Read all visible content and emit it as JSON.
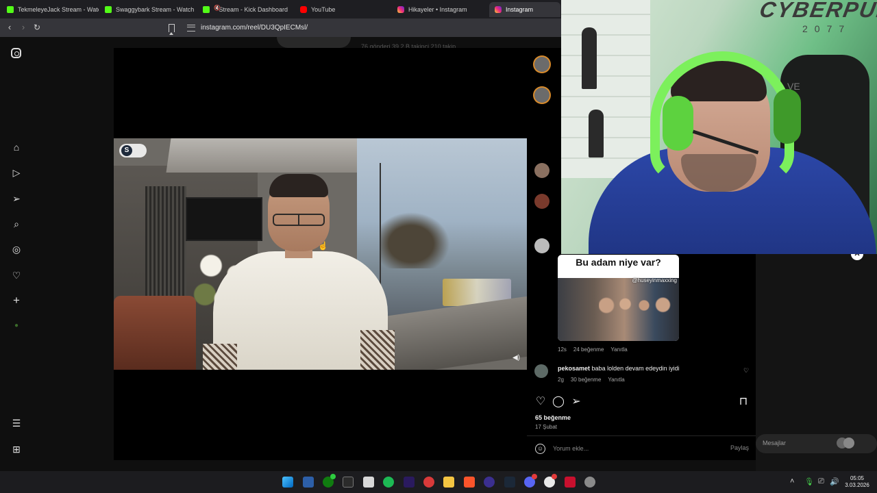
{
  "browser": {
    "tabs": [
      {
        "label": "TekmeleyeJack Stream - Watch",
        "favicon": "kick-icon"
      },
      {
        "label": "Swaggybark Stream - Watch Li",
        "favicon": "kick-icon"
      },
      {
        "label": "Stream - Kick Dashboard",
        "favicon": "kick-icon"
      },
      {
        "label": "YouTube",
        "favicon": "youtube-icon"
      },
      {
        "label": "Hikayeler • Instagram",
        "favicon": "instagram-icon"
      },
      {
        "label": "Instagram",
        "favicon": "instagram-icon"
      }
    ],
    "url": "instagram.com/reel/DU3QpIECMsl/"
  },
  "profile_ghost": {
    "stats": "76 gönderi    39,2 B takipçi    210 takip"
  },
  "post": {
    "comments": [
      {
        "user": "pekosamet",
        "text": "baba lolden devam edeydin iyidi",
        "age": "2g",
        "likes": "30 beğenme",
        "reply": "Yanıtla"
      }
    ],
    "meme_comment": {
      "image_title": "Bu adam niye var?",
      "image_handle": "@huseyinmaxxing",
      "age": "12s",
      "likes": "24 beğenme",
      "reply": "Yanıtla"
    },
    "likes_total": "65 beğenme",
    "date": "17 Şubat",
    "comment_placeholder": "Yorum ekle...",
    "share_label": "Paylaş"
  },
  "messages": {
    "label": "Mesajlar"
  },
  "webcam": {
    "logo_text": "CYBERPUNK",
    "logo_sub": "2077",
    "chair_text": "VE"
  },
  "taskbar": {
    "time": "05:05",
    "date": "3.03.2026"
  },
  "colors": {
    "kick_green": "#53fc18",
    "instagram_gradient_mid": "#ee2a7b",
    "panel_bg": "#000000"
  }
}
